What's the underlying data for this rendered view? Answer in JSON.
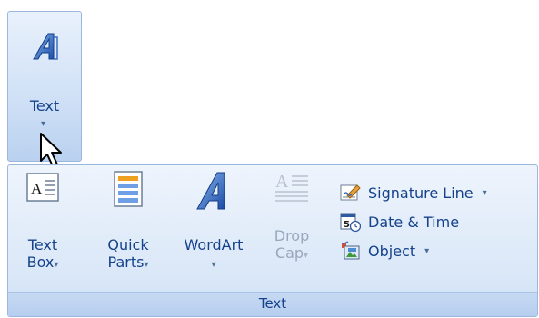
{
  "collapsed_group": {
    "label": "Text",
    "dropdown_glyph": "▾",
    "icon": "wordart-a-icon"
  },
  "panel": {
    "group_label": "Text",
    "buttons": [
      {
        "name": "text-box",
        "line1": "Text",
        "line2": "Box",
        "caret": "▾",
        "icon": "text-box-icon",
        "enabled": true
      },
      {
        "name": "quick-parts",
        "line1": "Quick",
        "line2": "Parts",
        "caret": "▾",
        "icon": "quick-parts-icon",
        "enabled": true
      },
      {
        "name": "wordart",
        "line1": "WordArt",
        "line2": "",
        "caret": "▾",
        "icon": "wordart-icon",
        "enabled": true
      },
      {
        "name": "drop-cap",
        "line1": "Drop",
        "line2": "Cap",
        "caret": "▾",
        "icon": "drop-cap-icon",
        "enabled": false
      }
    ],
    "small_buttons": [
      {
        "label": "Signature Line",
        "caret": "▾",
        "icon": "signature-line-icon"
      },
      {
        "label": "Date & Time",
        "caret": "",
        "icon": "date-time-icon"
      },
      {
        "label": "Object",
        "caret": "▾",
        "icon": "object-icon"
      }
    ]
  },
  "colors": {
    "label_text": "#15428b",
    "ribbon_border": "#9bb7dd",
    "disabled_text": "#98a7bb"
  }
}
